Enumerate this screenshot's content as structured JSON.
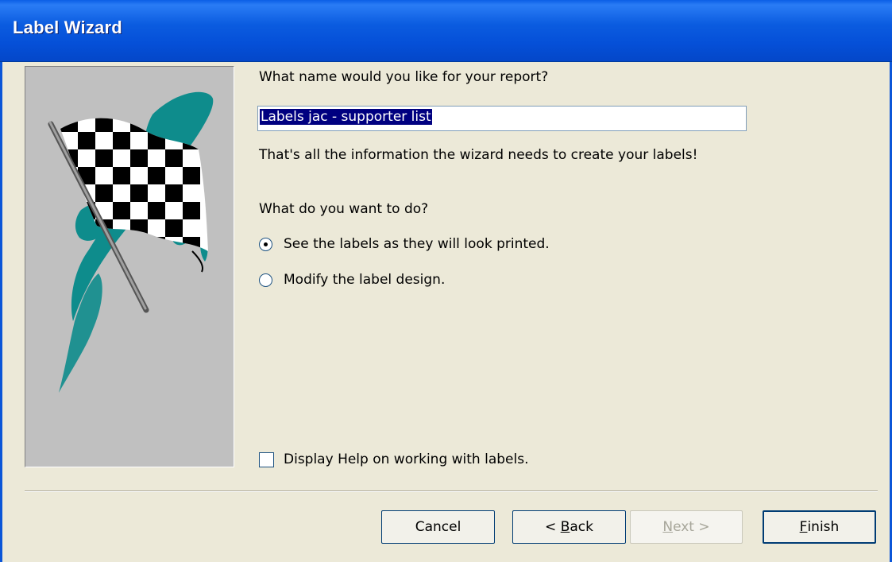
{
  "window": {
    "title": "Label Wizard"
  },
  "form": {
    "report_name_prompt": "What name would you like for your report?",
    "report_name_value": "Labels jac - supporter list",
    "info_text": "That's all the information the wizard needs to create your labels!",
    "action_prompt": "What do you want to do?",
    "options": [
      {
        "label": "See the labels as they will look printed.",
        "selected": true
      },
      {
        "label": "Modify the label design.",
        "selected": false
      }
    ],
    "help_checkbox": {
      "label": "Display Help on working with labels.",
      "checked": false
    }
  },
  "buttons": {
    "cancel": "Cancel",
    "back_prefix": "< ",
    "back_mnemonic": "B",
    "back_rest": "ack",
    "next_mnemonic": "N",
    "next_rest": "ext >",
    "finish_mnemonic": "F",
    "finish_rest": "inish"
  },
  "icons": {
    "wizard_art": "checkered-flag-icon"
  },
  "colors": {
    "titlebar": "#0b5ce0",
    "dialog_bg": "#ece9d8",
    "art_bg": "#c0c0c0",
    "flag_swoosh": "#0e8c8c"
  }
}
